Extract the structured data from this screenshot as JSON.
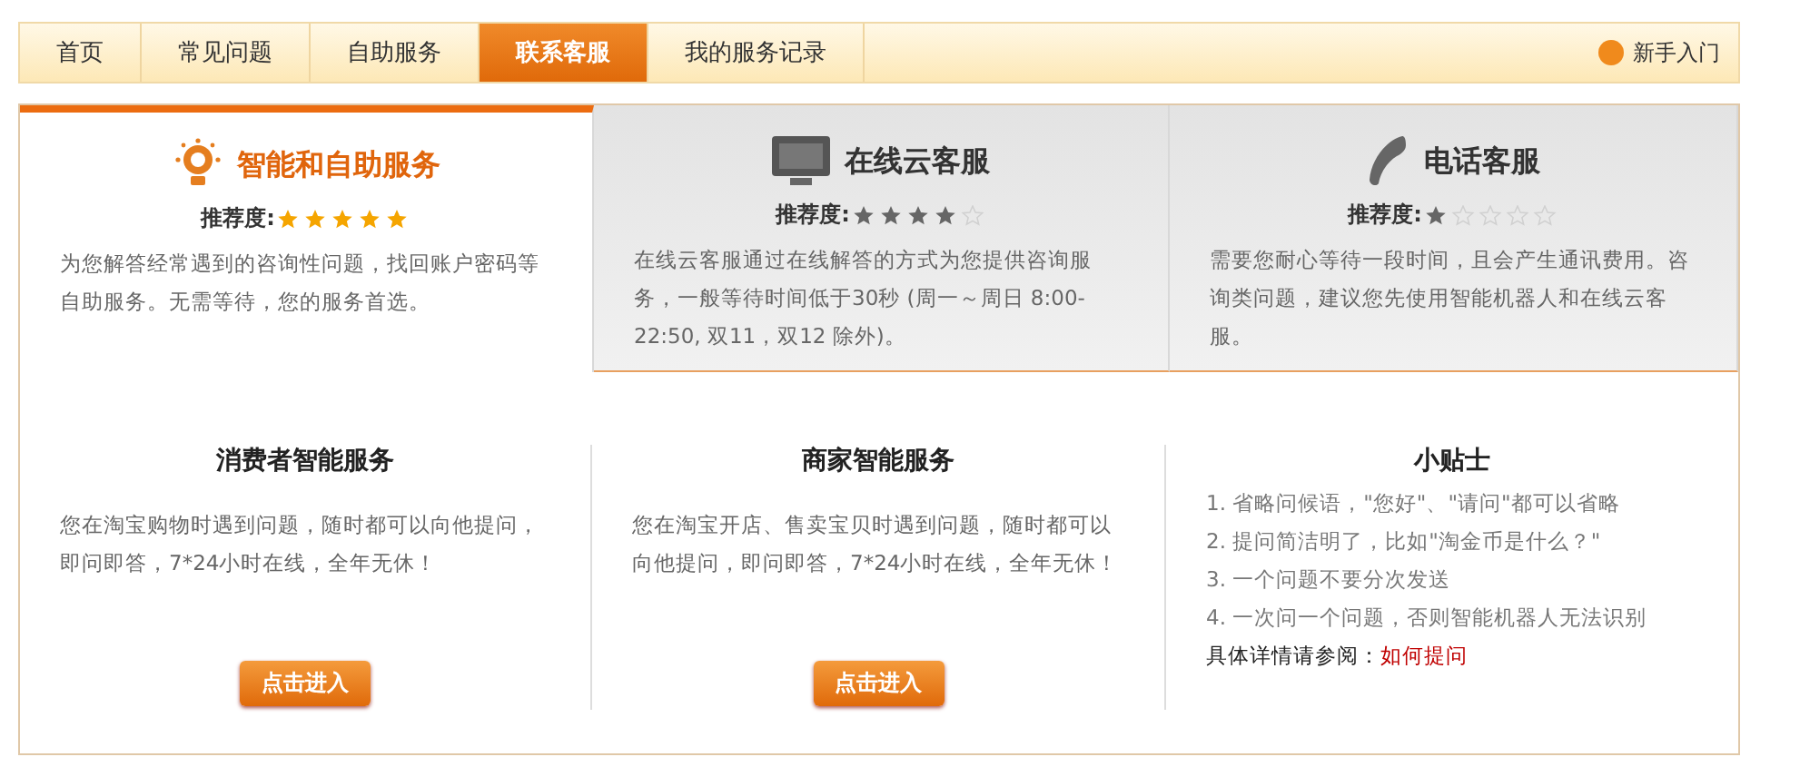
{
  "nav": {
    "tabs": [
      {
        "label": "首页",
        "selected": false
      },
      {
        "label": "常见问题",
        "selected": false
      },
      {
        "label": "自助服务",
        "selected": false
      },
      {
        "label": "联系客服",
        "selected": true
      },
      {
        "label": "我的服务记录",
        "selected": false
      }
    ],
    "help_link": "新手入门"
  },
  "service_tabs": [
    {
      "kind": "bulb",
      "title": "智能和自助服务",
      "rating_label": "推荐度:",
      "stars": 5,
      "selected": true,
      "description": "为您解答经常遇到的咨询性问题，找回账户密码等自助服务。无需等待，您的服务首选。"
    },
    {
      "kind": "monitor",
      "title": "在线云客服",
      "rating_label": "推荐度:",
      "stars": 4,
      "selected": false,
      "description": "在线云客服通过在线解答的方式为您提供咨询服务，一般等待时间低于30秒 (周一～周日 8:00-22:50, 双11，双12 除外)。"
    },
    {
      "kind": "phone",
      "title": "电话客服",
      "rating_label": "推荐度:",
      "stars": 1,
      "selected": false,
      "description": "需要您耐心等待一段时间，且会产生通讯费用。咨询类问题，建议您先使用智能机器人和在线云客服。"
    }
  ],
  "services": [
    {
      "title": "消费者智能服务",
      "description": "您在淘宝购物时遇到问题，随时都可以向他提问，即问即答，7*24小时在线，全年无休！",
      "button": "点击进入"
    },
    {
      "title": "商家智能服务",
      "description": "您在淘宝开店、售卖宝贝时遇到问题，随时都可以向他提问，即问即答，7*24小时在线，全年无休！",
      "button": "点击进入"
    }
  ],
  "tips": {
    "title": "小贴士",
    "items": [
      "1. 省略问候语，\"您好\"、\"请问\"都可以省略",
      "2. 提问简洁明了，比如\"淘金币是什么？\"",
      "3. 一个问题不要分次发送",
      "4. 一次问一个问题，否则智能机器人无法识别"
    ],
    "more_label": "具体详情请参阅：",
    "more_link": "如何提问"
  }
}
